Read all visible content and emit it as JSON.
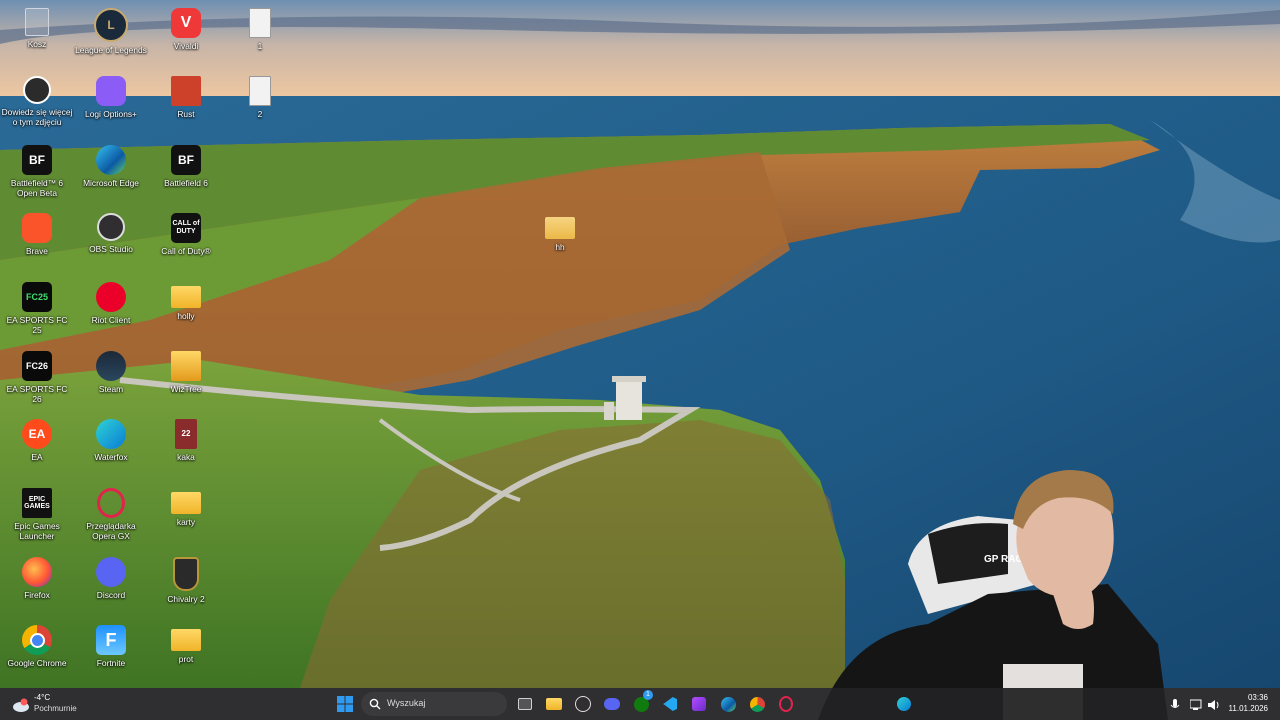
{
  "desktop": {
    "icons": [
      {
        "label": "Kosz",
        "icon": "recycle-bin-icon"
      },
      {
        "label": "League of Legends",
        "icon": "league-of-legends-icon"
      },
      {
        "label": "Vivaldi",
        "icon": "vivaldi-icon"
      },
      {
        "label": "1",
        "icon": "text-file-icon"
      },
      {
        "label": "Dowiedz się więcej o tym zdjęciu",
        "icon": "camera-info-icon"
      },
      {
        "label": "Logi Options+",
        "icon": "logi-options-icon"
      },
      {
        "label": "Rust",
        "icon": "rust-icon"
      },
      {
        "label": "2",
        "icon": "text-file-icon"
      },
      {
        "label": "Battlefield™ 6 Open Beta",
        "icon": "battlefield-icon"
      },
      {
        "label": "Microsoft Edge",
        "icon": "edge-icon"
      },
      {
        "label": "Battlefield 6",
        "icon": "battlefield-icon"
      },
      {
        "label": "Brave",
        "icon": "brave-icon"
      },
      {
        "label": "OBS Studio",
        "icon": "obs-icon"
      },
      {
        "label": "Call of Duty®",
        "icon": "call-of-duty-icon"
      },
      {
        "label": "hh",
        "icon": "folder-icon"
      },
      {
        "label": "EA SPORTS FC 25",
        "icon": "fc25-icon"
      },
      {
        "label": "Riot Client",
        "icon": "riot-client-icon"
      },
      {
        "label": "holly",
        "icon": "folder-icon"
      },
      {
        "label": "EA SPORTS FC 26",
        "icon": "fc26-icon"
      },
      {
        "label": "Steam",
        "icon": "steam-icon"
      },
      {
        "label": "WizTree",
        "icon": "wiztree-icon"
      },
      {
        "label": "EA",
        "icon": "ea-icon"
      },
      {
        "label": "Waterfox",
        "icon": "waterfox-icon"
      },
      {
        "label": "kaka",
        "icon": "archive-icon"
      },
      {
        "label": "Epic Games Launcher",
        "icon": "epic-games-icon"
      },
      {
        "label": "Przeglądarka Opera GX",
        "icon": "opera-gx-icon"
      },
      {
        "label": "karty",
        "icon": "folder-icon"
      },
      {
        "label": "Firefox",
        "icon": "firefox-icon"
      },
      {
        "label": "Discord",
        "icon": "discord-icon"
      },
      {
        "label": "Chivalry 2",
        "icon": "chivalry-icon"
      },
      {
        "label": "Google Chrome",
        "icon": "chrome-icon"
      },
      {
        "label": "Fortnite",
        "icon": "fortnite-icon"
      },
      {
        "label": "prot",
        "icon": "folder-icon"
      }
    ],
    "tile_text": {
      "bf": "BF",
      "cod": "CALL of DUTY",
      "fc25": "FC25",
      "fc26": "FC26",
      "ea": "EA",
      "epic": "EPIC GAMES",
      "fortnite": "F",
      "kaka": "22"
    }
  },
  "webcam": {
    "chair_text": "GP RACER"
  },
  "taskbar": {
    "weather": {
      "temp": "-4°C",
      "desc": "Pochmurnie",
      "icon": "cloudy-weather-icon"
    },
    "search_placeholder": "Wyszukaj",
    "pinned": [
      "task-view-icon",
      "file-explorer-icon",
      "obs-icon",
      "discord-icon",
      "xbox-icon",
      "vscode-icon",
      "app-icon",
      "edge-icon",
      "chrome-icon",
      "opera-gx-icon",
      "waterfox-icon"
    ],
    "xbox_badge": "1",
    "clock": {
      "time": "03:36",
      "date": "11.01.2026"
    }
  },
  "colors": {
    "taskbar": "#222224",
    "accent": "#0078d4",
    "sea": "#2f6f9a",
    "grass": "#4f8a2a",
    "cliff": "#a5672f"
  }
}
